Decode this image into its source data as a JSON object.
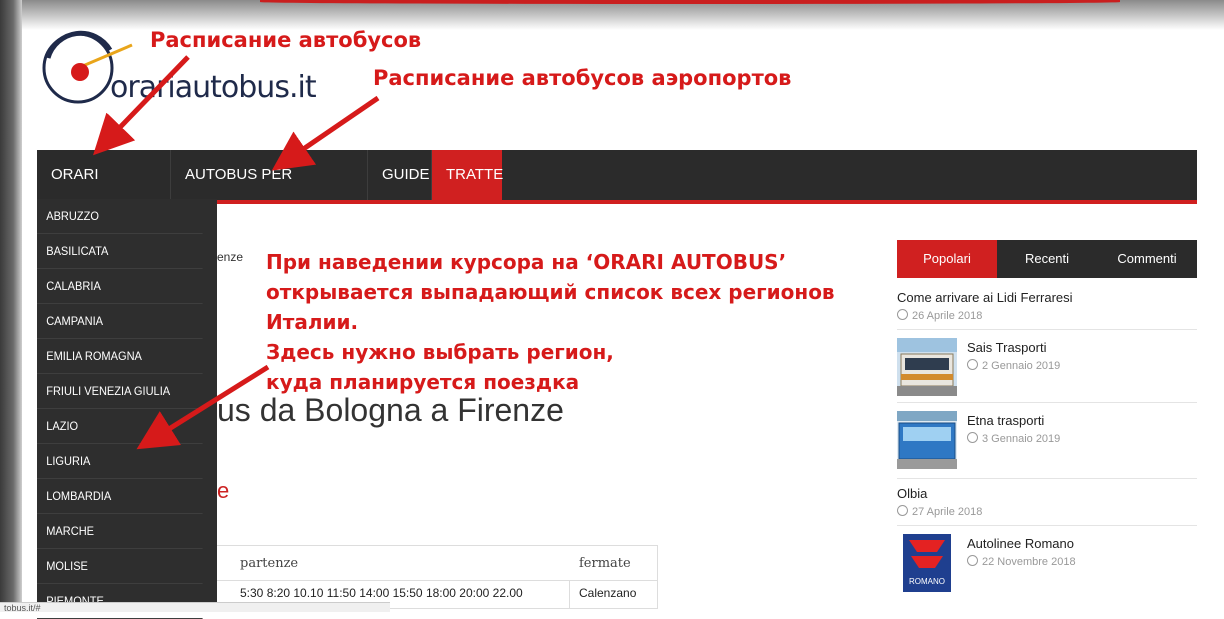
{
  "logo": {
    "text": "orariautobus.it"
  },
  "nav": {
    "items": [
      {
        "label": "ORARI AUTOBUS",
        "has_caret": true
      },
      {
        "label": "AUTOBUS PER AEROPORTO",
        "has_caret": true
      },
      {
        "label": "GUIDE",
        "has_caret": false
      },
      {
        "label": "TRATTE",
        "has_caret": false,
        "active": true
      }
    ],
    "caret": "▼"
  },
  "dropdown": {
    "items": [
      "ABRUZZO",
      "BASILICATA",
      "CALABRIA",
      "CAMPANIA",
      "EMILIA ROMAGNA",
      "FRIULI VENEZIA GIULIA",
      "LAZIO",
      "LIGURIA",
      "LOMBARDIA",
      "MARCHE",
      "MOLISE",
      "PIEMONTE"
    ]
  },
  "content": {
    "breadcrumb_tail": "enze",
    "heading": "us da Bologna a Firenze",
    "subheading": "e",
    "table": {
      "headers": [
        "partenze",
        "fermate"
      ],
      "rows": [
        {
          "times": "5:30 8:20 10.10 11:50 14:00 15:50 18:00 20:00 22.00",
          "stop": "Calenzano"
        }
      ]
    }
  },
  "sidebar": {
    "tabs": [
      "Popolari",
      "Recenti",
      "Commenti"
    ],
    "posts": [
      {
        "title": "Come arrivare ai Lidi Ferraresi",
        "date": "26 Aprile 2018",
        "thumb": "none"
      },
      {
        "title": "Sais Trasporti",
        "date": "2 Gennaio 2019",
        "thumb": "bus-photo"
      },
      {
        "title": "Etna trasporti",
        "date": "3 Gennaio 2019",
        "thumb": "bus-photo"
      },
      {
        "title": "Olbia",
        "date": "27 Aprile 2018",
        "thumb": "none"
      },
      {
        "title": "Autolinee Romano",
        "date": "22 Novembre 2018",
        "thumb": "romano-logo",
        "logo_text": "ROMANO"
      }
    ]
  },
  "annotations": {
    "a1": "Расписание автобусов",
    "a2": "Расписание автобусов аэропортов",
    "a3": [
      "При наведении курсора на ‘ORARI AUTOBUS’",
      "открывается выпадающий список всех регионов",
      "Италии.",
      "Здесь нужно выбрать регион,",
      "куда планируется поездка"
    ],
    "color": "#d61a1a"
  },
  "status_bar": {
    "text": "tobus.it/#"
  },
  "colors": {
    "accent": "#d02020",
    "nav_bg": "#2b2b2b"
  }
}
